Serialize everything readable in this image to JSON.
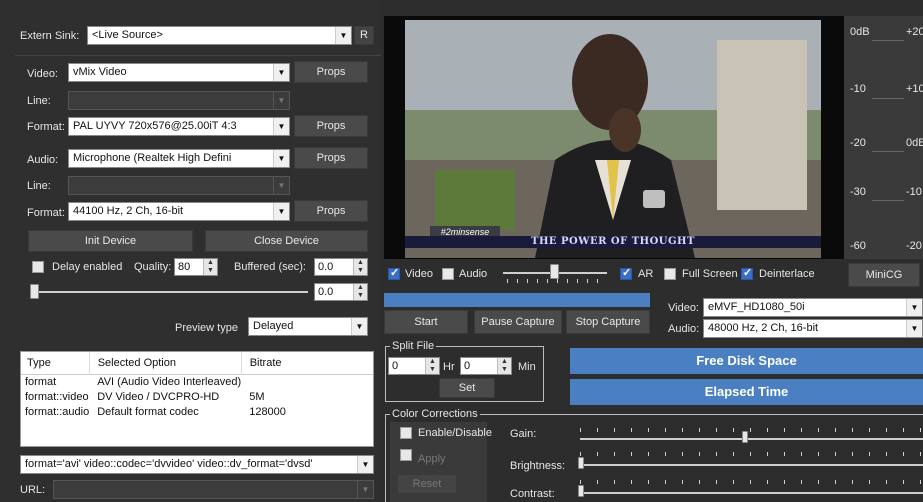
{
  "extern_sink": {
    "label": "Extern Sink:",
    "value": "<Live Source>",
    "r_button": "R"
  },
  "video": {
    "label": "Video:",
    "value": "vMix Video",
    "props": "Props"
  },
  "video_line": {
    "label": "Line:",
    "value": ""
  },
  "video_format": {
    "label": "Format:",
    "value": "PAL UYVY 720x576@25.00iT 4:3",
    "props": "Props"
  },
  "audio": {
    "label": "Audio:",
    "value": "Microphone (Realtek High Defini",
    "props": "Props"
  },
  "audio_line": {
    "label": "Line:",
    "value": ""
  },
  "audio_format": {
    "label": "Format:",
    "value": "44100 Hz, 2 Ch, 16-bit",
    "props": "Props"
  },
  "device_buttons": {
    "init": "Init Device",
    "close": "Close Device"
  },
  "delay": {
    "label": "Delay enabled",
    "checked": false,
    "quality_label": "Quality:",
    "quality_value": "80",
    "buffered_label": "Buffered (sec):",
    "buffered_value": "0.0",
    "slider_value": "0.0"
  },
  "preview": {
    "label": "Preview type",
    "value": "Delayed"
  },
  "options_table": {
    "headers": [
      "Type",
      "Selected Option",
      "Bitrate"
    ],
    "rows": [
      [
        "format",
        "AVI (Audio Video Interleaved)",
        ""
      ],
      [
        "format::video",
        "DV Video / DVCPRO-HD",
        "5M"
      ],
      [
        "format::audio",
        "Default format codec",
        "128000"
      ]
    ]
  },
  "format_string": "format='avi' video::codec='dvvideo' video::dv_format='dvsd'",
  "url": {
    "label": "URL:",
    "value": ""
  },
  "video_preview": {
    "bug_text": "#2minsense",
    "banner_text": "THE POWER OF THOUGHT"
  },
  "meter": {
    "left_labels": [
      "0dB",
      "-10",
      "-20",
      "-30",
      "-60"
    ],
    "right_labels": [
      "+20",
      "+10",
      "0dB",
      "-10",
      "-20"
    ]
  },
  "toggles": {
    "video": "Video",
    "audio": "Audio",
    "ar": "AR",
    "full_screen": "Full Screen",
    "deinterlace": "Deinterlace"
  },
  "minicg": "MiniCG",
  "capture": {
    "start": "Start",
    "pause": "Pause Capture",
    "stop": "Stop Capture"
  },
  "output": {
    "video_label": "Video:",
    "video_value": "eMVF_HD1080_50i",
    "audio_label": "Audio:",
    "audio_value": "48000 Hz, 2 Ch, 16-bit"
  },
  "split_file": {
    "legend": "Split File",
    "hr_value": "0",
    "hr_label": "Hr",
    "min_value": "0",
    "min_label": "Min",
    "set": "Set"
  },
  "status_bars": {
    "free_disk": "Free Disk Space",
    "elapsed": "Elapsed Time"
  },
  "color_corrections": {
    "legend": "Color Corrections",
    "enable": "Enable/Disable",
    "apply": "Apply",
    "reset": "Reset",
    "gain": "Gain:",
    "brightness": "Brightness:",
    "contrast": "Contrast:"
  },
  "colors": {
    "accent_blue": "#4a7fc1",
    "bg": "#2d2d2d",
    "check_blue": "#3c6ec6"
  }
}
